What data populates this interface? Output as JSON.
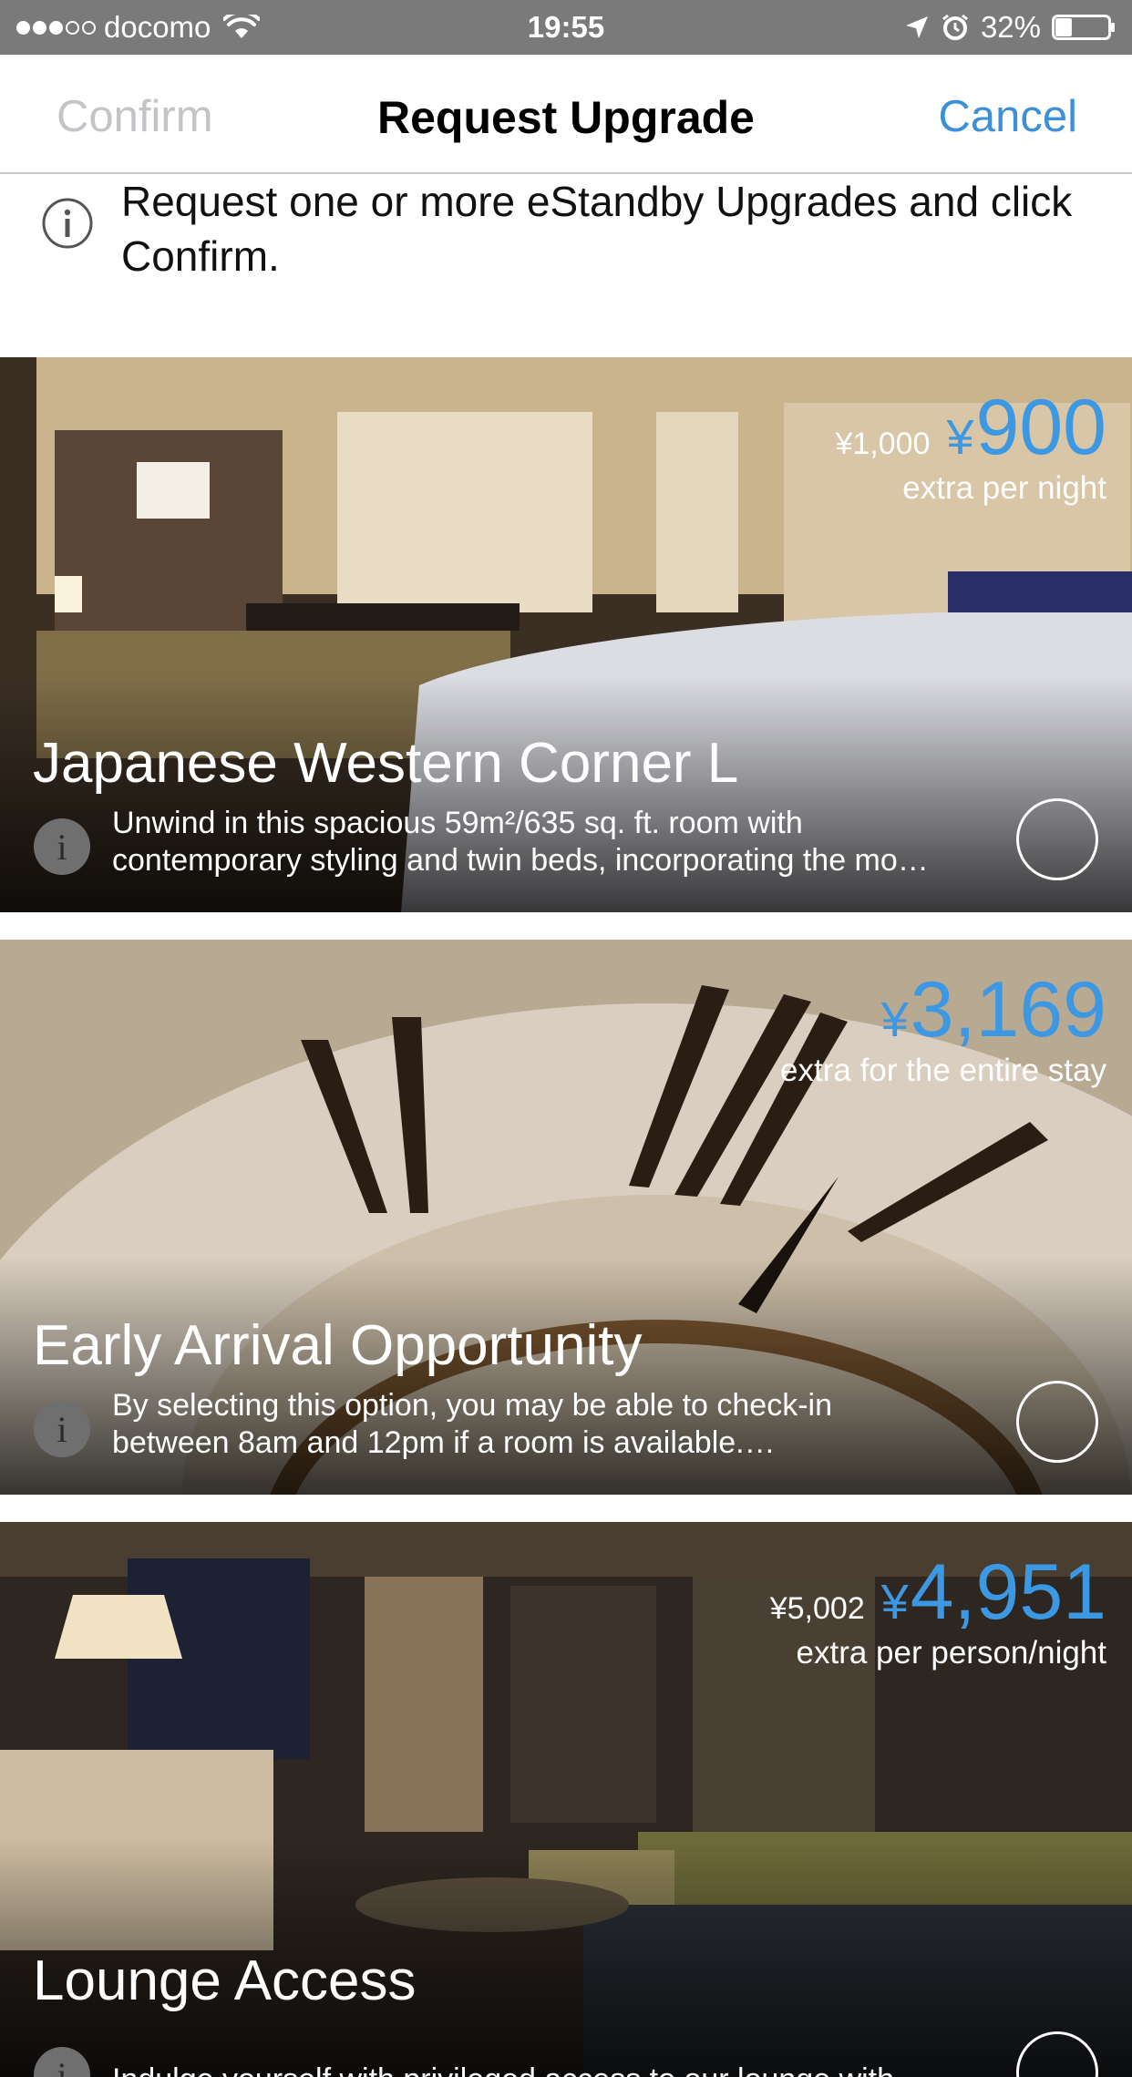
{
  "status_bar": {
    "carrier": "docomo",
    "signal_bars": 3,
    "time": "19:55",
    "battery": "32%",
    "battery_level": 0.32
  },
  "nav": {
    "confirm_label": "Confirm",
    "title": "Request Upgrade",
    "cancel_label": "Cancel"
  },
  "notice": {
    "text": "Request one or more eStandby Upgrades and click Confirm."
  },
  "upgrades": [
    {
      "title": "Japanese Western Corner L",
      "original_price": "¥1,000",
      "currency": "¥",
      "price": "900",
      "unit": "extra per night",
      "description_line1": "Unwind in this spacious 59m²/635 sq. ft. room with",
      "description_line2": "contemporary styling and twin beds, incorporating the mo…",
      "selected": false
    },
    {
      "title": "Early Arrival Opportunity",
      "original_price": "",
      "currency": "¥",
      "price": "3,169",
      "unit": "extra for the entire stay",
      "description_line1": "By selecting this option, you may be able to check-in",
      "description_line2": "between 8am and 12pm if a room is available.…",
      "selected": false
    },
    {
      "title": "Lounge Access",
      "original_price": "¥5,002",
      "currency": "¥",
      "price": "4,951",
      "unit": "extra per person/night",
      "description_line1": "Indulge yourself with privileged access to our lounge with",
      "description_line2": "",
      "selected": false
    }
  ],
  "colors": {
    "accent": "#3d98e3",
    "status_bar": "#7a7a7a",
    "disabled": "#c4c4c8"
  }
}
